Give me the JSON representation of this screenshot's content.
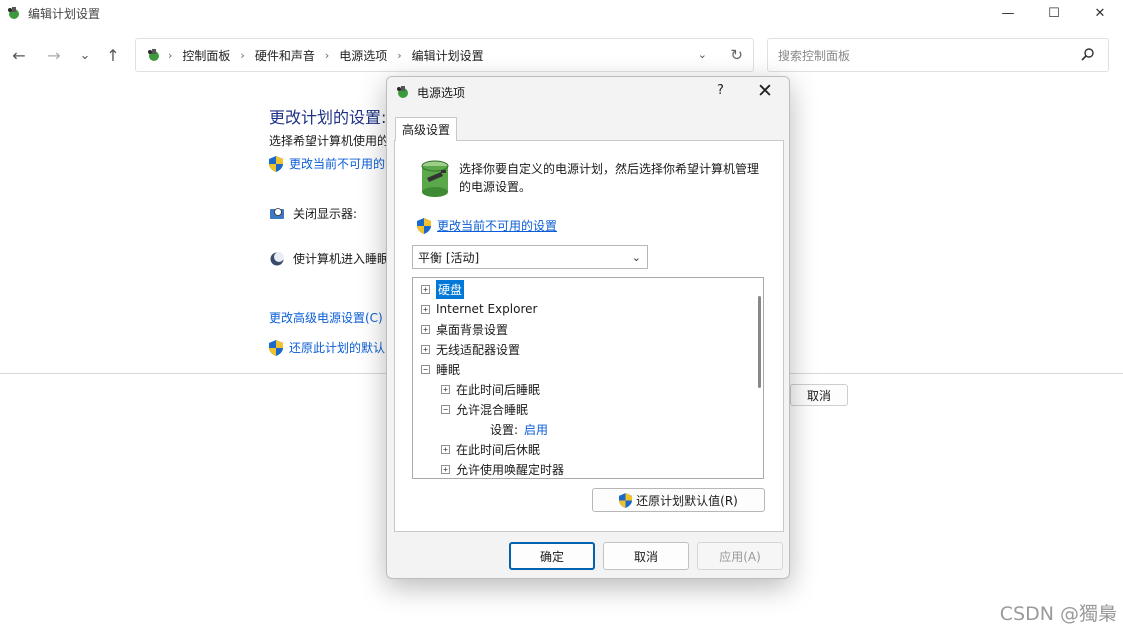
{
  "window": {
    "title": "编辑计划设置",
    "controls": {
      "minimize": "—",
      "maximize": "☐",
      "close": "✕"
    }
  },
  "nav": {
    "back": "←",
    "forward": "→",
    "recent": "⌄",
    "up": "↑",
    "breadcrumb": [
      "控制面板",
      "硬件和声音",
      "电源选项",
      "编辑计划设置"
    ],
    "dropdown_glyph": "⌄",
    "refresh_glyph": "↻",
    "search_placeholder": "搜索控制面板"
  },
  "content": {
    "title": "更改计划的设置:",
    "desc": "选择希望计算机使用的",
    "change_unavailable_link": "更改当前不可用的",
    "display_off_label": "关闭显示器:",
    "sleep_label": "使计算机进入睡眠",
    "advanced_link": "更改高级电源设置(C)",
    "restore_link": "还原此计划的默认",
    "cancel_button": "取消"
  },
  "dialog": {
    "title": "电源选项",
    "help": "?",
    "close": "✕",
    "tab": "高级设置",
    "description": "选择你要自定义的电源计划，然后选择你希望计算机管理的电源设置。",
    "change_unavailable": "更改当前不可用的设置",
    "plan_selected": "平衡 [活动]",
    "tree": [
      {
        "label": "硬盘",
        "expander": "+",
        "selected": true
      },
      {
        "label": "Internet Explorer",
        "expander": "+"
      },
      {
        "label": "桌面背景设置",
        "expander": "+"
      },
      {
        "label": "无线适配器设置",
        "expander": "+"
      },
      {
        "label": "睡眠",
        "expander": "−"
      },
      {
        "label": "在此时间后睡眠",
        "expander": "+"
      },
      {
        "label": "允许混合睡眠",
        "expander": "−"
      },
      {
        "label": "设置:",
        "value": "启用"
      },
      {
        "label": "在此时间后休眠",
        "expander": "+"
      },
      {
        "label": "允许使用唤醒定时器",
        "expander": "+"
      }
    ],
    "restore_defaults": "还原计划默认值(R)",
    "ok": "确定",
    "cancel": "取消",
    "apply": "应用(A)"
  },
  "watermark": "CSDN @獨梟",
  "colors": {
    "accent": "#0078d7",
    "link": "#0b5ed7",
    "heading": "#1e3287"
  }
}
